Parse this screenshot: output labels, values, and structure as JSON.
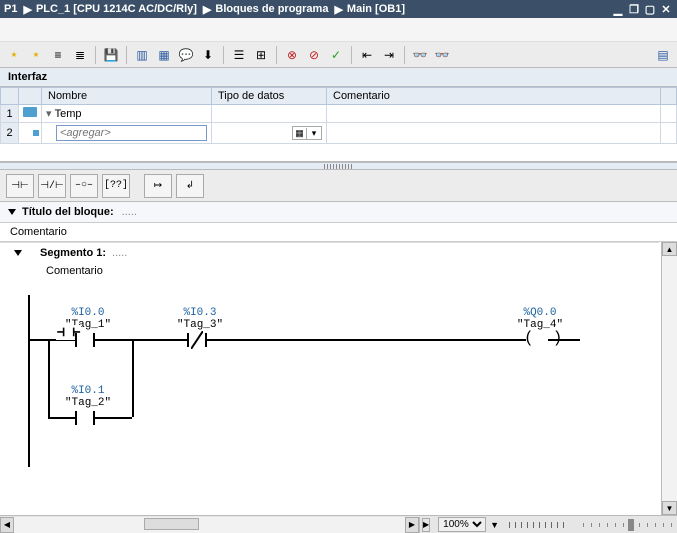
{
  "titlebar": {
    "crumbs": [
      "P1",
      "PLC_1 [CPU 1214C AC/DC/Rly]",
      "Bloques de programa",
      "Main [OB1]"
    ]
  },
  "interface": {
    "label": "Interfaz",
    "cols": {
      "name": "Nombre",
      "datatype": "Tipo de datos",
      "comment": "Comentario"
    },
    "row1": {
      "num": "1",
      "label": "Temp"
    },
    "row2": {
      "num": "2",
      "placeholder": "<agregar>"
    }
  },
  "block": {
    "title_label": "Título del bloque:",
    "title_value": ".....",
    "comment": "Comentario"
  },
  "segment": {
    "label": "Segmento 1:",
    "dots": ".....",
    "comment": "Comentario"
  },
  "ladder": {
    "c1": {
      "addr": "%I0.0",
      "tag": "\"Tag_1\""
    },
    "c2": {
      "addr": "%I0.3",
      "tag": "\"Tag_3\""
    },
    "c3": {
      "addr": "%I0.1",
      "tag": "\"Tag_2\""
    },
    "coil": {
      "addr": "%Q0.0",
      "tag": "\"Tag_4\""
    }
  },
  "zoom": {
    "value": "100%"
  }
}
